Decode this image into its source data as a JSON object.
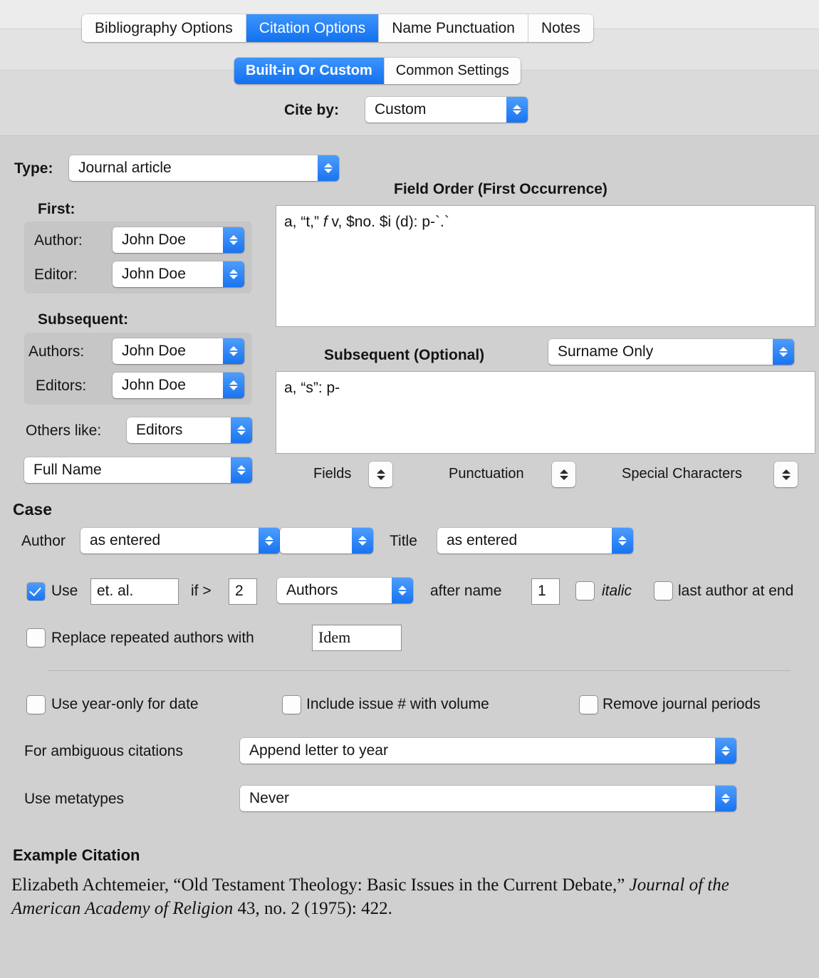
{
  "tabs": [
    {
      "label": "Bibliography Options",
      "selected": false
    },
    {
      "label": "Citation Options",
      "selected": true
    },
    {
      "label": "Name Punctuation",
      "selected": false
    },
    {
      "label": "Notes",
      "selected": false
    }
  ],
  "segments": [
    {
      "label": "Built-in Or Custom",
      "selected": true
    },
    {
      "label": "Common Settings",
      "selected": false
    }
  ],
  "cite_by": {
    "label": "Cite by:",
    "value": "Custom"
  },
  "type_row": {
    "label": "Type:",
    "value": "Journal article"
  },
  "first": {
    "heading": "First:",
    "author_label": "Author:",
    "author_value": "John Doe",
    "editor_label": "Editor:",
    "editor_value": "John Doe"
  },
  "subsequent": {
    "heading": "Subsequent:",
    "authors_label": "Authors:",
    "authors_value": "John Doe",
    "editors_label": "Editors:",
    "editors_value": "John Doe"
  },
  "others_like": {
    "label": "Others like:",
    "value": "Editors"
  },
  "name_format": {
    "value": "Full Name"
  },
  "field_order": {
    "heading": "Field Order (First Occurrence)",
    "text_before": "a, “t,” ",
    "text_italic": "f",
    "text_after": " v, $no. $i (d): p-`.`"
  },
  "subsequent_optional": {
    "heading": "Subsequent (Optional)",
    "mode": "Surname Only",
    "text": "a, “s”: p-"
  },
  "inserters": [
    {
      "label": "Fields"
    },
    {
      "label": "Punctuation"
    },
    {
      "label": "Special Characters"
    }
  ],
  "case": {
    "heading": "Case",
    "author_label": "Author",
    "author_value": "as entered",
    "author_value2": "",
    "title_label": "Title",
    "title_value": "as entered"
  },
  "etal": {
    "use_checked": true,
    "use_label": "Use",
    "etal_value": "et. al.",
    "if_label": "if >",
    "count_value": "2",
    "kind_value": "Authors",
    "after_label": "after name",
    "after_value": "1",
    "italic_label": "italic",
    "italic_checked": false,
    "last_author_label": "last author at end",
    "last_author_checked": false
  },
  "replace_repeated": {
    "checked": false,
    "label": "Replace repeated authors with",
    "value": "Idem"
  },
  "options_row": [
    {
      "label": "Use year-only for date",
      "checked": false
    },
    {
      "label": "Include issue # with volume",
      "checked": false
    },
    {
      "label": "Remove journal periods",
      "checked": false
    }
  ],
  "ambiguous": {
    "label": "For ambiguous citations",
    "value": "Append letter to year"
  },
  "metatypes": {
    "label": "Use metatypes",
    "value": "Never"
  },
  "example": {
    "heading": "Example Citation",
    "part1": "Elizabeth Achtemeier, “Old Testament Theology: Basic Issues in the Current Debate,” ",
    "part_italic": "Journal of the American Academy of Religion",
    "part2": " 43, no. 2 (1975): 422."
  },
  "colors": {
    "accent": "#1a74f0",
    "window_bg": "#d0d0d0",
    "group_bg": "#c6c6c6"
  }
}
